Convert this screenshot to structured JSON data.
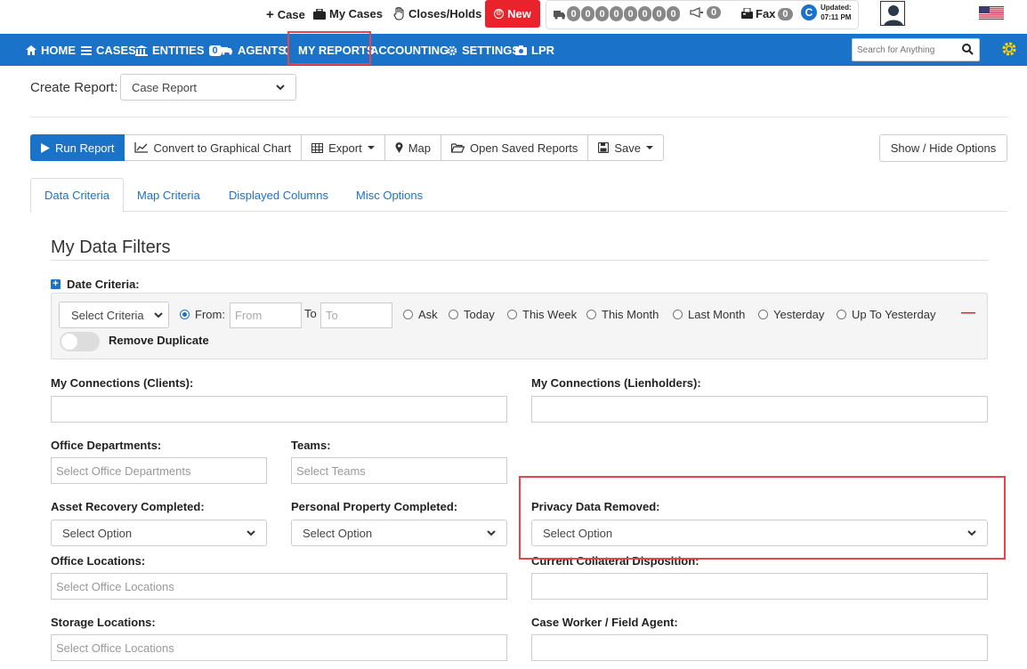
{
  "topbar": {
    "case_label": "Case",
    "my_cases_label": "My Cases",
    "closes_holds_label": "Closes/Holds",
    "new_label": "New",
    "counters": [
      "0",
      "0",
      "0",
      "0",
      "0",
      "0",
      "0",
      "0"
    ],
    "announce_count": "0",
    "fax_label": "Fax",
    "fax_count": "0",
    "updated_label": "Updated:",
    "updated_time": "07:11 PM"
  },
  "nav": {
    "items": [
      "HOME",
      "CASES",
      "ENTITIES",
      "AGENTS",
      "MY REPORTS",
      "ACCOUNTING",
      "SETTINGS",
      "LPR"
    ],
    "entities_badge": "0",
    "search_placeholder": "Search for Anything"
  },
  "create_report": {
    "label": "Create Report:",
    "selected": "Case Report"
  },
  "toolbar": {
    "run": "Run Report",
    "chart": "Convert to Graphical Chart",
    "export": "Export",
    "map": "Map",
    "open_saved": "Open Saved Reports",
    "save": "Save",
    "show_hide": "Show / Hide Options"
  },
  "tabs": [
    "Data Criteria",
    "Map Criteria",
    "Displayed Columns",
    "Misc Options"
  ],
  "filters": {
    "title": "My Data Filters",
    "date_criteria_label": "Date Criteria:",
    "select_criteria": "Select Criteria",
    "from_label": "From:",
    "from_placeholder": "From",
    "to_label": "To",
    "to_placeholder": "To",
    "radio_options": [
      "Ask",
      "Today",
      "This Week",
      "This Month",
      "Last Month",
      "Yesterday",
      "Up To Yesterday"
    ],
    "remove_duplicate": "Remove Duplicate",
    "connections_clients": "My Connections (Clients):",
    "connections_lienholders": "My Connections (Lienholders):",
    "office_departments": "Office Departments:",
    "office_departments_placeholder": "Select Office Departments",
    "teams": "Teams:",
    "teams_placeholder": "Select Teams",
    "asset_recovery": "Asset Recovery Completed:",
    "personal_property": "Personal Property Completed:",
    "privacy_data": "Privacy Data Removed:",
    "select_option": "Select Option",
    "office_locations": "Office Locations:",
    "office_locations_placeholder": "Select Office Locations",
    "current_collateral": "Current Collateral Disposition:",
    "storage_locations": "Storage Locations:",
    "storage_locations_placeholder": "Select Office Locations",
    "case_worker": "Case Worker / Field Agent:"
  }
}
